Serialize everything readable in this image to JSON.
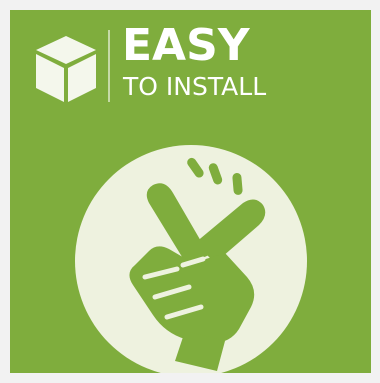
{
  "badge": {
    "title": "EASY",
    "subtitle": "TO INSTALL"
  },
  "colors": {
    "background": "#7fad3d",
    "foreground": "#ffffff",
    "circle": "#eef2df",
    "hand": "#7fad3d"
  },
  "icons": {
    "cube": "cube-icon",
    "hand": "finger-snap-icon"
  }
}
